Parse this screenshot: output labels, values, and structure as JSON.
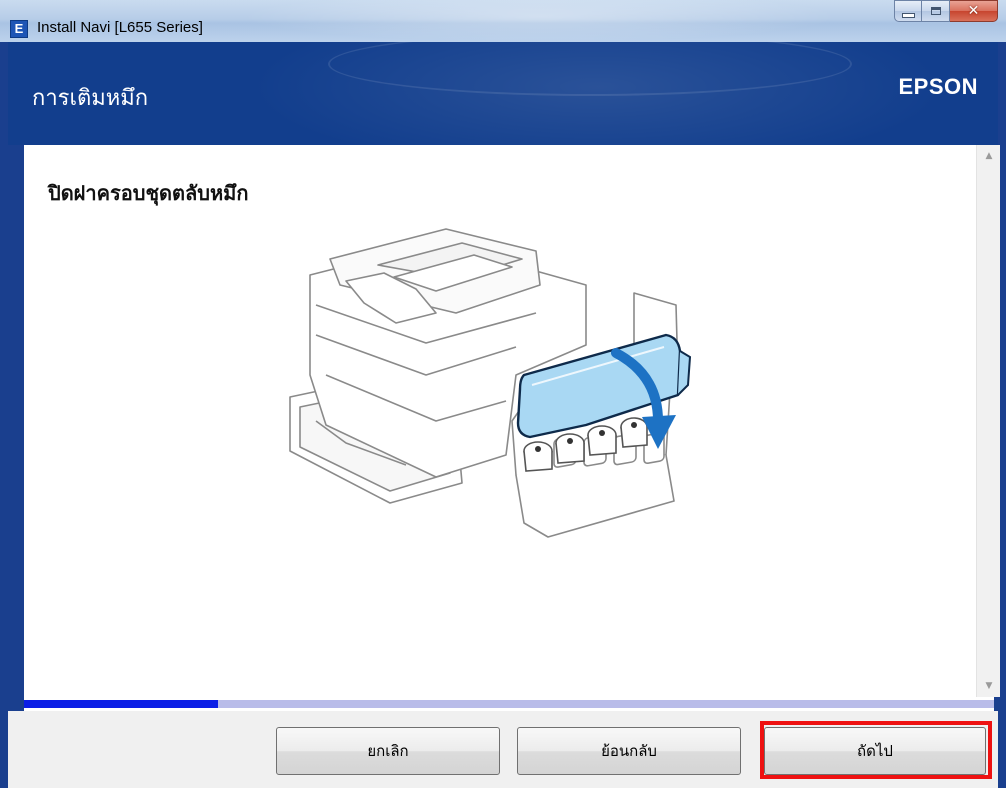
{
  "window": {
    "title": "Install Navi [L655 Series]",
    "icon_letter": "E",
    "controls": {
      "minimize": "minimize-icon",
      "maximize": "maximize-icon",
      "close": "close-icon"
    }
  },
  "header": {
    "title": "การเติมหมึก",
    "brand": "EPSON"
  },
  "main": {
    "step_heading": "ปิดฝาครอบชุดตลับหมึก",
    "illustration": "printer-closing-ink-tank-cover"
  },
  "progress": {
    "fraction": 0.2
  },
  "footer": {
    "cancel_label": "ยกเลิก",
    "back_label": "ย้อนกลับ",
    "next_label": "ถัดไป",
    "highlighted": "next"
  },
  "colors": {
    "header_bg": "#123e8d",
    "progress_fill": "#0c1fe6",
    "progress_track": "#b9bce9",
    "highlight": "#ee1111",
    "cover_blue": "#a9d8f3",
    "arrow_blue": "#1d72c4"
  }
}
